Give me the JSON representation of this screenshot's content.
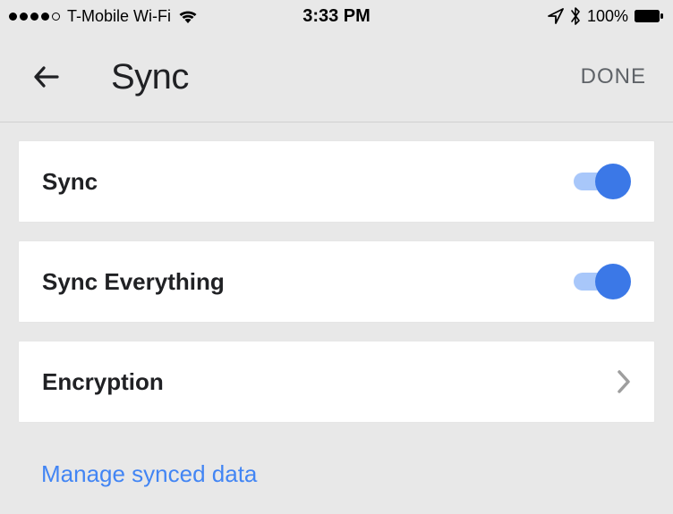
{
  "statusBar": {
    "carrier": "T-Mobile Wi-Fi",
    "time": "3:33 PM",
    "batteryPct": "100%"
  },
  "header": {
    "title": "Sync",
    "done": "DONE"
  },
  "rows": {
    "sync": {
      "label": "Sync",
      "on": true
    },
    "syncEverything": {
      "label": "Sync Everything",
      "on": true
    },
    "encryption": {
      "label": "Encryption"
    }
  },
  "manageLink": "Manage synced data"
}
